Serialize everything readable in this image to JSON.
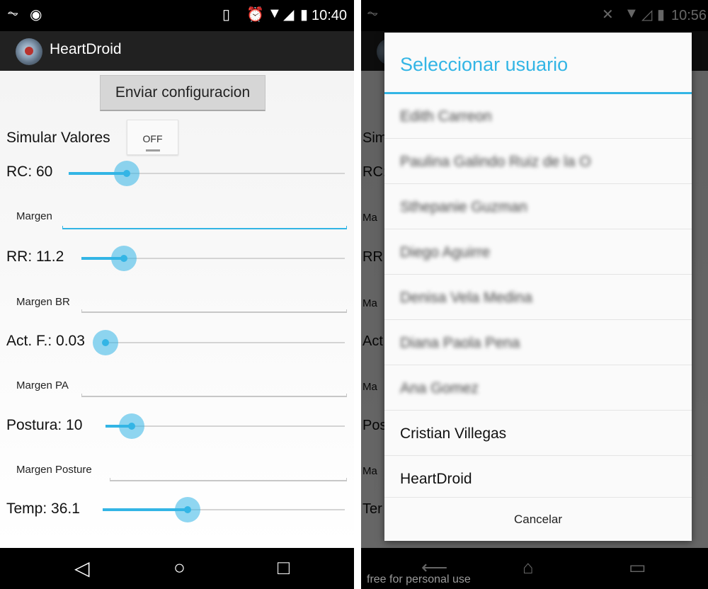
{
  "left": {
    "status_time": "10:40",
    "app_title": "HeartDroid",
    "send_button": "Enviar configuracion",
    "simulate_label": "Simular Valores",
    "simulate_toggle": "OFF",
    "sliders": [
      {
        "label": "RC: 60",
        "value": 0.21
      },
      {
        "label": "RR: 11.2",
        "value": 0.16
      },
      {
        "label": "Act. F.: 0.03",
        "value": 0.0
      },
      {
        "label": "Postura: 10",
        "value": 0.11
      },
      {
        "label": "Temp: 36.1",
        "value": 0.35
      }
    ],
    "fields": [
      {
        "label": "Margen"
      },
      {
        "label": "Margen BR"
      },
      {
        "label": "Margen PA"
      },
      {
        "label": "Margen Posture"
      }
    ],
    "nav": {
      "back": "◁",
      "home": "○",
      "recents": "□"
    }
  },
  "right": {
    "status_time": "10:56",
    "background_labels": [
      "Sim",
      "RC:",
      "Ma",
      "RR",
      "Ma",
      "Act",
      "Ma",
      "Pos",
      "Ma",
      "Ter"
    ],
    "dialog": {
      "title": "Seleccionar usuario",
      "users": [
        "Edith Carreon",
        "Paulina Galindo Ruiz de la O",
        "Sthepanie Guzman",
        "Diego Aguirre",
        "Denisa Vela Medina",
        "Diana Paola Pena",
        "Ana Gomez",
        "Cristian Villegas",
        "HeartDroid"
      ],
      "cancel": "Cancelar"
    },
    "watermark": "free for personal use"
  },
  "colors": {
    "accent": "#33b5e5",
    "actionbar": "#212121"
  }
}
